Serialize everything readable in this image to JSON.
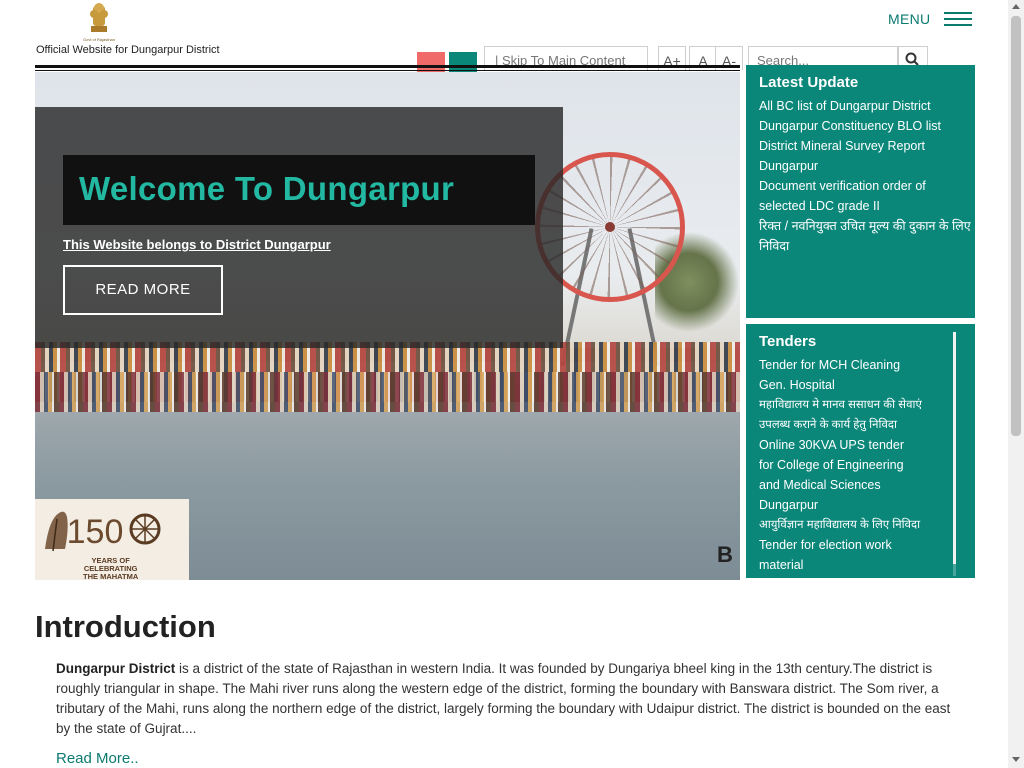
{
  "header": {
    "emblem_caption": "Govt of Rajasthan",
    "tagline": "Official Website for Dungarpur District",
    "menu_label": "MENU",
    "skip_link": "| Skip To Main Content",
    "font_increase": "A+",
    "font_normal": "A",
    "font_decrease": "A-",
    "search_placeholder": "Search...",
    "theme_colors": [
      "#f06a6a",
      "#0b877a"
    ]
  },
  "hero": {
    "title": "Welcome To Dungarpur",
    "subtitle": "This Website belongs to District Dungarpur",
    "button_label": "READ MORE",
    "badge_number": "150",
    "badge_text": "YEARS OF\nCELEBRATING\nTHE MAHATMA",
    "corner_letter": "B"
  },
  "latest_update": {
    "title": "Latest Update",
    "items": [
      "All BC list of Dungarpur District",
      "Dungarpur Constituency BLO list",
      "District Mineral Survey Report",
      "Dungarpur",
      "Document verification order of",
      "selected LDC grade II",
      "रिक्त / नवनियुक्त उचित मूल्य की दुकान के लिए",
      "निविदा"
    ]
  },
  "tenders": {
    "title": "Tenders",
    "items": [
      "Tender for MCH Cleaning",
      "Gen. Hospital",
      "महाविद्यालय मे मानव ससाधन की सेवाएं",
      "उपलब्ध कराने के कार्य हेतु निविदा",
      "Online 30KVA UPS tender",
      "for College of Engineering",
      "and Medical Sciences",
      "Dungarpur",
      "आयुर्विज्ञान महाविद्यालय के लिए निविदा",
      "Tender for election work",
      "material"
    ]
  },
  "introduction": {
    "title": "Introduction",
    "lead": "Dungarpur District",
    "body": " is a district of the state of Rajasthan in western India. It was founded by Dungariya bheel king in the 13th century.The district is roughly triangular in shape. The Mahi river runs along the western edge of the district, forming the boundary with Banswara district. The Som river, a tributary of the Mahi, runs along the northern edge of the district, largely forming the boundary with Udaipur district. The district is bounded on the east by the state of Gujrat....",
    "read_more": "Read More.."
  }
}
